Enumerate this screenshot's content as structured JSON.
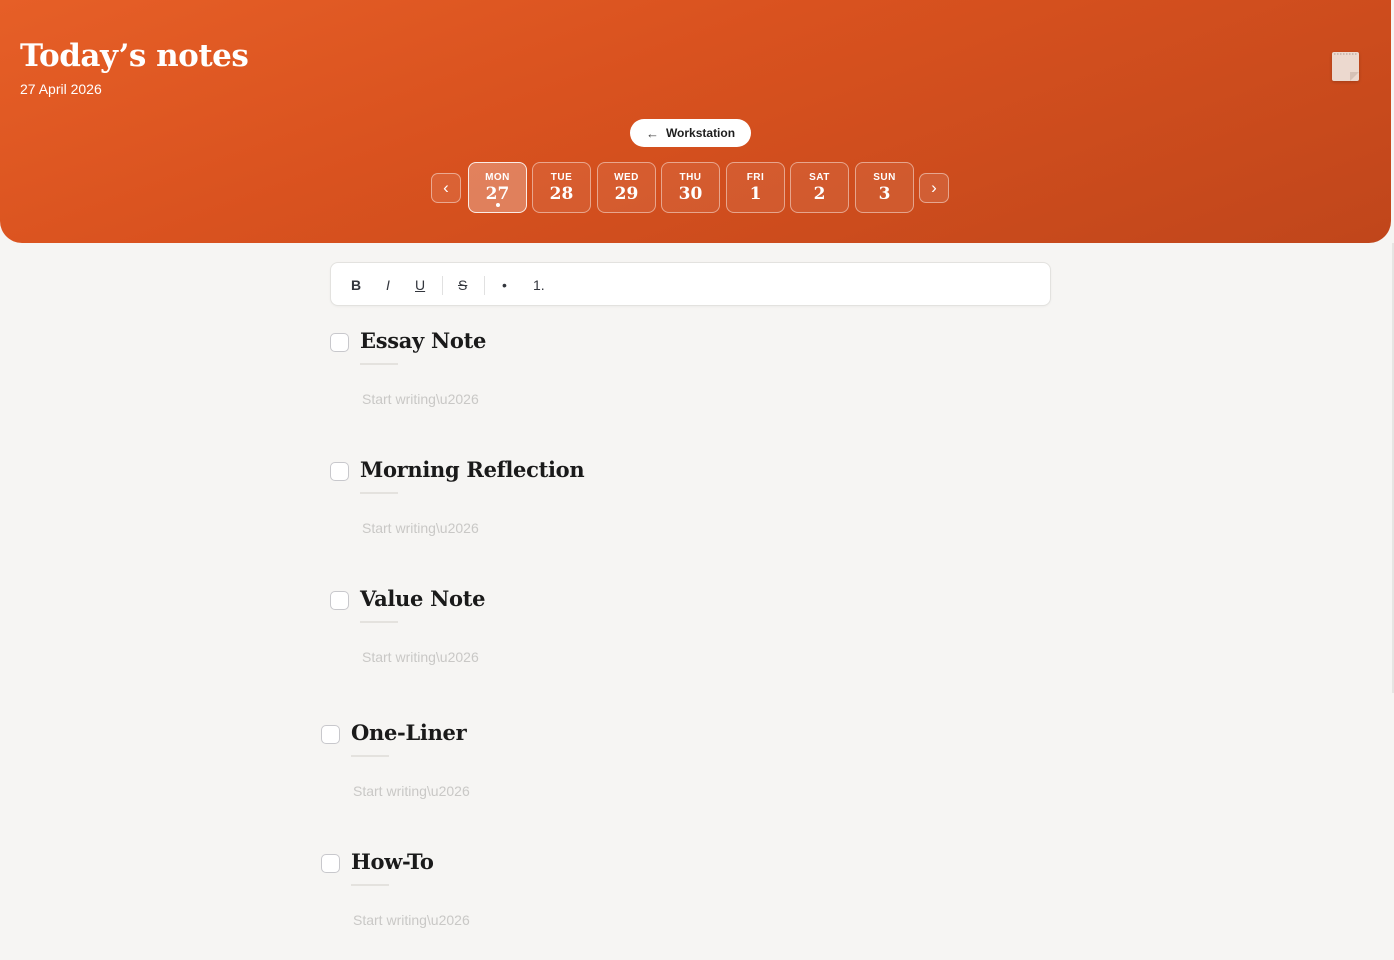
{
  "header": {
    "title": "Today’s notes",
    "date": "27 April 2026",
    "workstation_label": "Workstation",
    "back_arrow": "←",
    "prev": "‹",
    "next": "›",
    "notepad_icon": "notepad-icon"
  },
  "week": {
    "days": [
      {
        "name": "MON",
        "num": "27",
        "selected": true
      },
      {
        "name": "TUE",
        "num": "28",
        "selected": false
      },
      {
        "name": "WED",
        "num": "29",
        "selected": false
      },
      {
        "name": "THU",
        "num": "30",
        "selected": false
      },
      {
        "name": "FRI",
        "num": "1",
        "selected": false
      },
      {
        "name": "SAT",
        "num": "2",
        "selected": false
      },
      {
        "name": "SUN",
        "num": "3",
        "selected": false
      }
    ]
  },
  "toolbar": {
    "bold": "B",
    "italic": "I",
    "underline": "U",
    "strike": "S",
    "bullet": "•",
    "numbered": "1."
  },
  "notes": [
    {
      "title": "Essay Note",
      "placeholder": "Start writing\\u2026"
    },
    {
      "title": "Morning Reflection",
      "placeholder": "Start writing\\u2026"
    },
    {
      "title": "Value Note",
      "placeholder": "Start writing\\u2026"
    },
    {
      "title": "One-Liner",
      "placeholder": "Start writing\\u2026"
    },
    {
      "title": "How-To",
      "placeholder": "Start writing\\u2026"
    }
  ],
  "colors": {
    "header_start": "#e65f27",
    "header_end": "#c0461b",
    "background": "#f6f5f3"
  }
}
